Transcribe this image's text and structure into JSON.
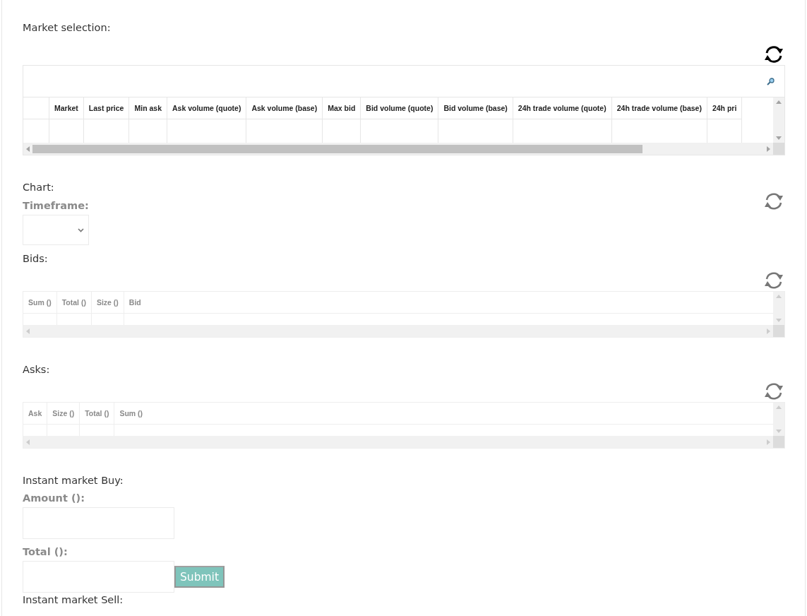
{
  "sections": [
    {
      "kind": "market_table",
      "label": "Market selection:",
      "refresh_highlighted": true,
      "columns": [
        "Market",
        "Last price",
        "Min ask",
        "Ask volume (quote)",
        "Ask volume (base)",
        "Max bid",
        "Bid volume (quote)",
        "Bid volume (base)",
        "24h trade volume (quote)",
        "24h trade volume (base)",
        "24h pri"
      ]
    },
    {
      "kind": "chart",
      "label": "Chart:",
      "field_label": "Timeframe:",
      "refresh_highlighted": false
    },
    {
      "kind": "order_table",
      "label": "Bids:",
      "refresh_highlighted": false,
      "columns": [
        "Sum ()",
        "Total ()",
        "Size ()",
        "Bid"
      ]
    },
    {
      "kind": "order_table",
      "label": "Asks:",
      "refresh_highlighted": false,
      "columns": [
        "Ask",
        "Size ()",
        "Total ()",
        "Sum ()"
      ]
    },
    {
      "kind": "order_form",
      "label": "Instant market Buy:",
      "fields": [
        {
          "label": "Amount ():"
        },
        {
          "label": "Total ():"
        }
      ],
      "button": "Submit"
    },
    {
      "kind": "heading",
      "label": "Instant market Sell:"
    }
  ]
}
